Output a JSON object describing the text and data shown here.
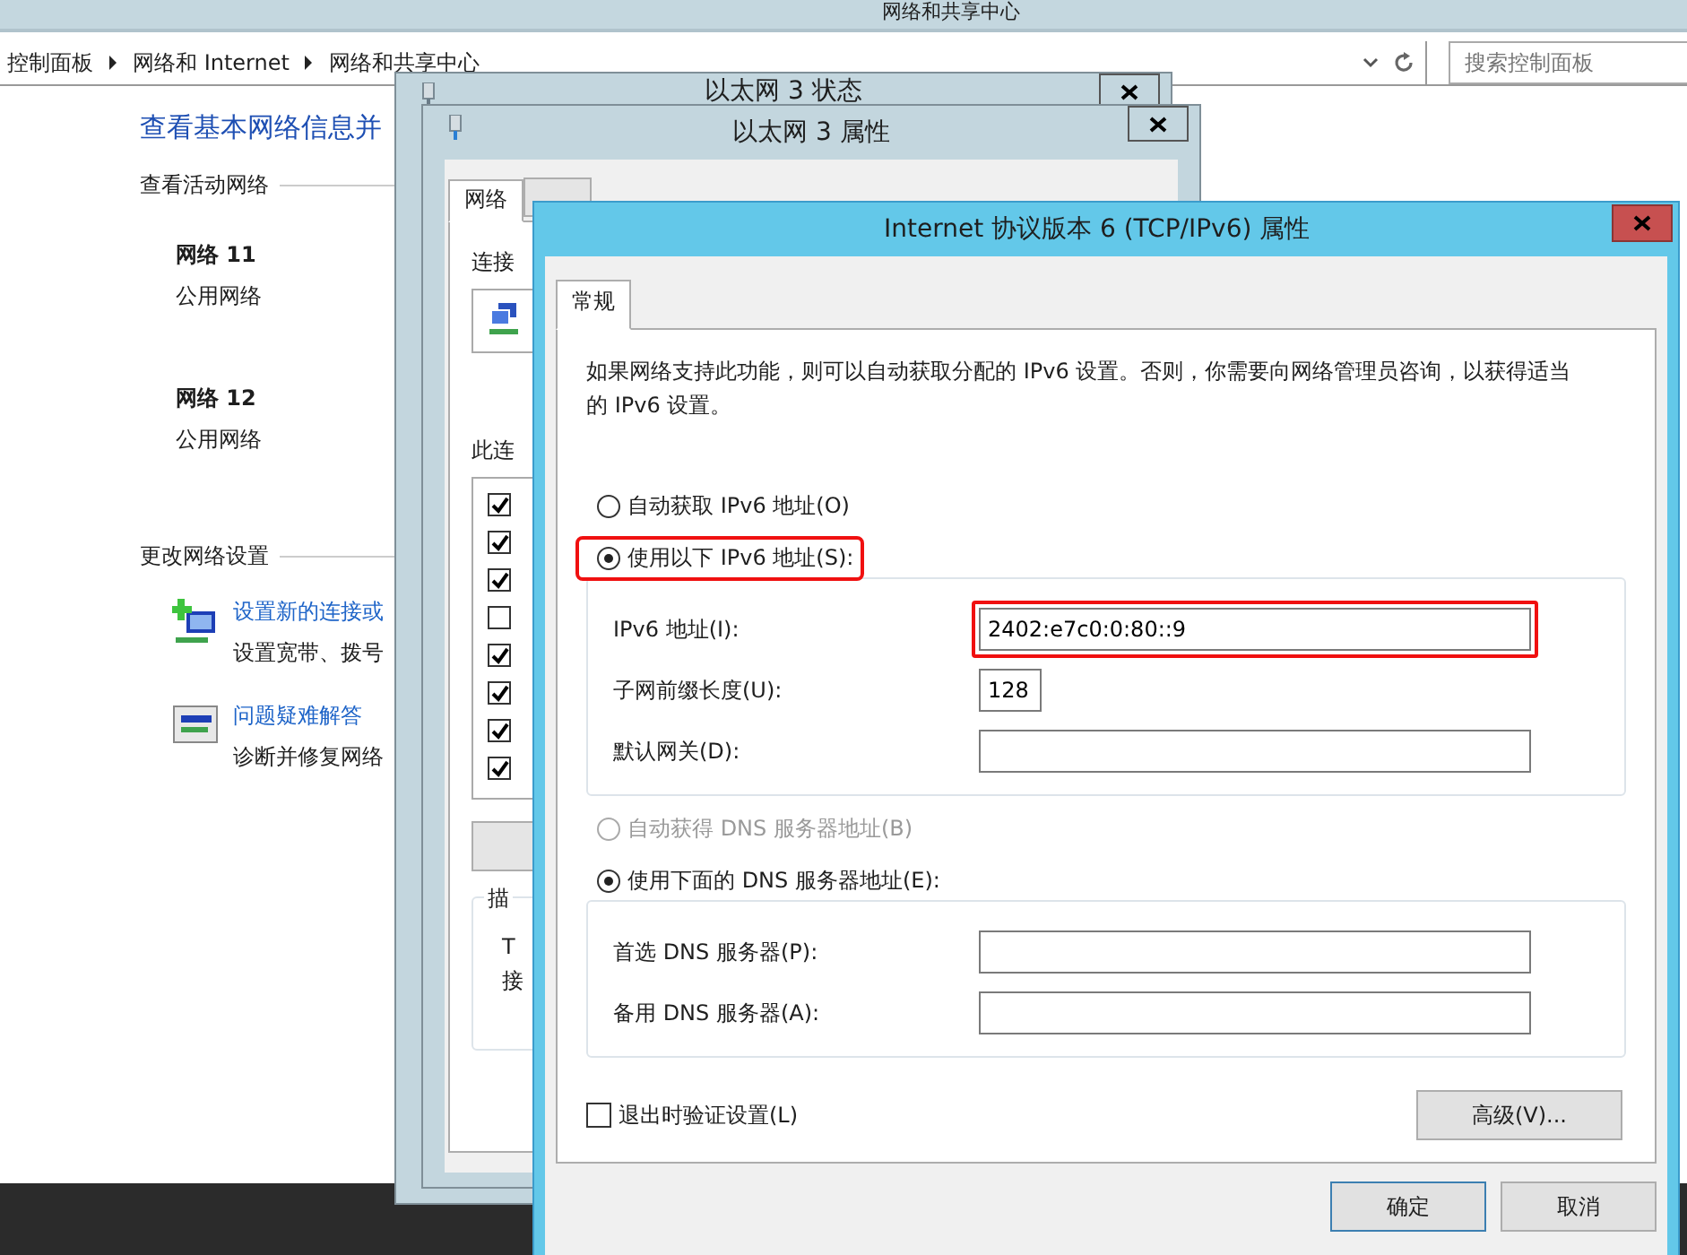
{
  "main_window": {
    "title": "网络和共享中心",
    "breadcrumb": [
      {
        "label": "控制面板"
      },
      {
        "label": "网络和 Internet"
      },
      {
        "label": "网络和共享中心"
      }
    ],
    "search": {
      "placeholder": "搜索控制面板"
    },
    "heading": "查看基本网络信息并",
    "active_networks_label": "查看活动网络",
    "networks": [
      {
        "name": "网络  11",
        "category": "公用网络"
      },
      {
        "name": "网络  12",
        "category": "公用网络"
      }
    ],
    "change_settings_label": "更改网络设置",
    "tasks": [
      {
        "kind": "new-connection",
        "link": "设置新的连接或",
        "description": "设置宽带、拨号"
      },
      {
        "kind": "troubleshoot",
        "link": "问题疑难解答",
        "description": "诊断并修复网络"
      }
    ]
  },
  "status_window": {
    "title": "以太网 3 状态"
  },
  "properties_window": {
    "title": "以太网 3 属性",
    "tabs": [
      {
        "label": "网络",
        "selected": true
      },
      {
        "selected": false
      }
    ],
    "connect_using_label": "连接",
    "items_label": "此连",
    "items": [
      {
        "checked": true
      },
      {
        "checked": true
      },
      {
        "checked": true
      },
      {
        "checked": false
      },
      {
        "checked": true
      },
      {
        "checked": true
      },
      {
        "checked": true
      },
      {
        "checked": true
      }
    ],
    "description_label": "描",
    "description_lines": [
      "T",
      "接"
    ]
  },
  "ipv6_dialog": {
    "title": "Internet 协议版本 6 (TCP/IPv6) 属性",
    "tabs": [
      {
        "label": "常规",
        "selected": true
      }
    ],
    "intro": "如果网络支持此功能，则可以自动获取分配的 IPv6 设置。否则，你需要向网络管理员咨询，以获得适当的 IPv6 设置。",
    "address_options": [
      {
        "label": "自动获取 IPv6 地址(O)",
        "selected": false,
        "disabled": false,
        "highlighted": false
      },
      {
        "label": "使用以下 IPv6 地址(S):",
        "selected": true,
        "disabled": false,
        "highlighted": true
      }
    ],
    "address_fields": [
      {
        "label": "IPv6 地址(I):",
        "value": "2402:e7c0:0:80::9",
        "kind": "wide",
        "highlighted": true
      },
      {
        "label": "子网前缀长度(U):",
        "value": "128",
        "kind": "short",
        "highlighted": false
      },
      {
        "label": "默认网关(D):",
        "kind": "wide",
        "highlighted": false
      }
    ],
    "dns_options": [
      {
        "label": "自动获得 DNS 服务器地址(B)",
        "selected": false,
        "disabled": true,
        "highlighted": false
      },
      {
        "label": "使用下面的 DNS 服务器地址(E):",
        "selected": true,
        "disabled": false,
        "highlighted": false
      }
    ],
    "dns_fields": [
      {
        "label": "首选 DNS 服务器(P):",
        "kind": "wide",
        "highlighted": false
      },
      {
        "label": "备用 DNS 服务器(A):",
        "kind": "wide",
        "highlighted": false
      }
    ],
    "validate": {
      "label": "退出时验证设置(L)",
      "checked": false
    },
    "advanced_button": "高级(V)...",
    "buttons": [
      {
        "label": "确定",
        "default": true
      },
      {
        "label": "取消",
        "default": false
      }
    ]
  }
}
